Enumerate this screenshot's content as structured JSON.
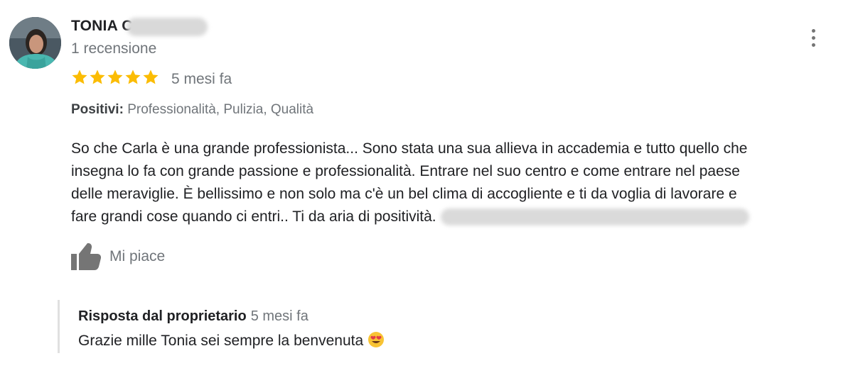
{
  "review": {
    "author_name": "TONIA C",
    "review_count": "1 recensione",
    "rating": 5,
    "rating_max": 5,
    "date": "5 mesi fa",
    "positives_label": "Positivi:",
    "positives_values": "Professionalità, Pulizia, Qualità",
    "text_lines": [
      "So che Carla è una grande professionista... Sono stata una sua allieva in accademia e tutto quello che",
      "insegna lo fa con grande passione e professionalità. Entrare nel suo centro e come entrare nel paese",
      "delle meraviglie. È bellissimo e non solo ma c'è un bel clima di accogliente e ti da voglia di lavorare e",
      "fare grandi cose quando ci entri.. Ti da aria di positività."
    ],
    "like_label": "Mi piace"
  },
  "owner_reply": {
    "title": "Risposta dal proprietario",
    "date": "5 mesi fa",
    "text": "Grazie mille Tonia sei sempre la benvenuta"
  },
  "icons": {
    "star": "star-icon",
    "like": "thumbs-up-icon",
    "menu": "more-vert-icon",
    "emoji": "heart-eyes-emoji"
  },
  "colors": {
    "star": "#fbbc04",
    "secondary_text": "#70757a",
    "primary_text": "#202124",
    "reply_border": "#e0e0e0"
  }
}
